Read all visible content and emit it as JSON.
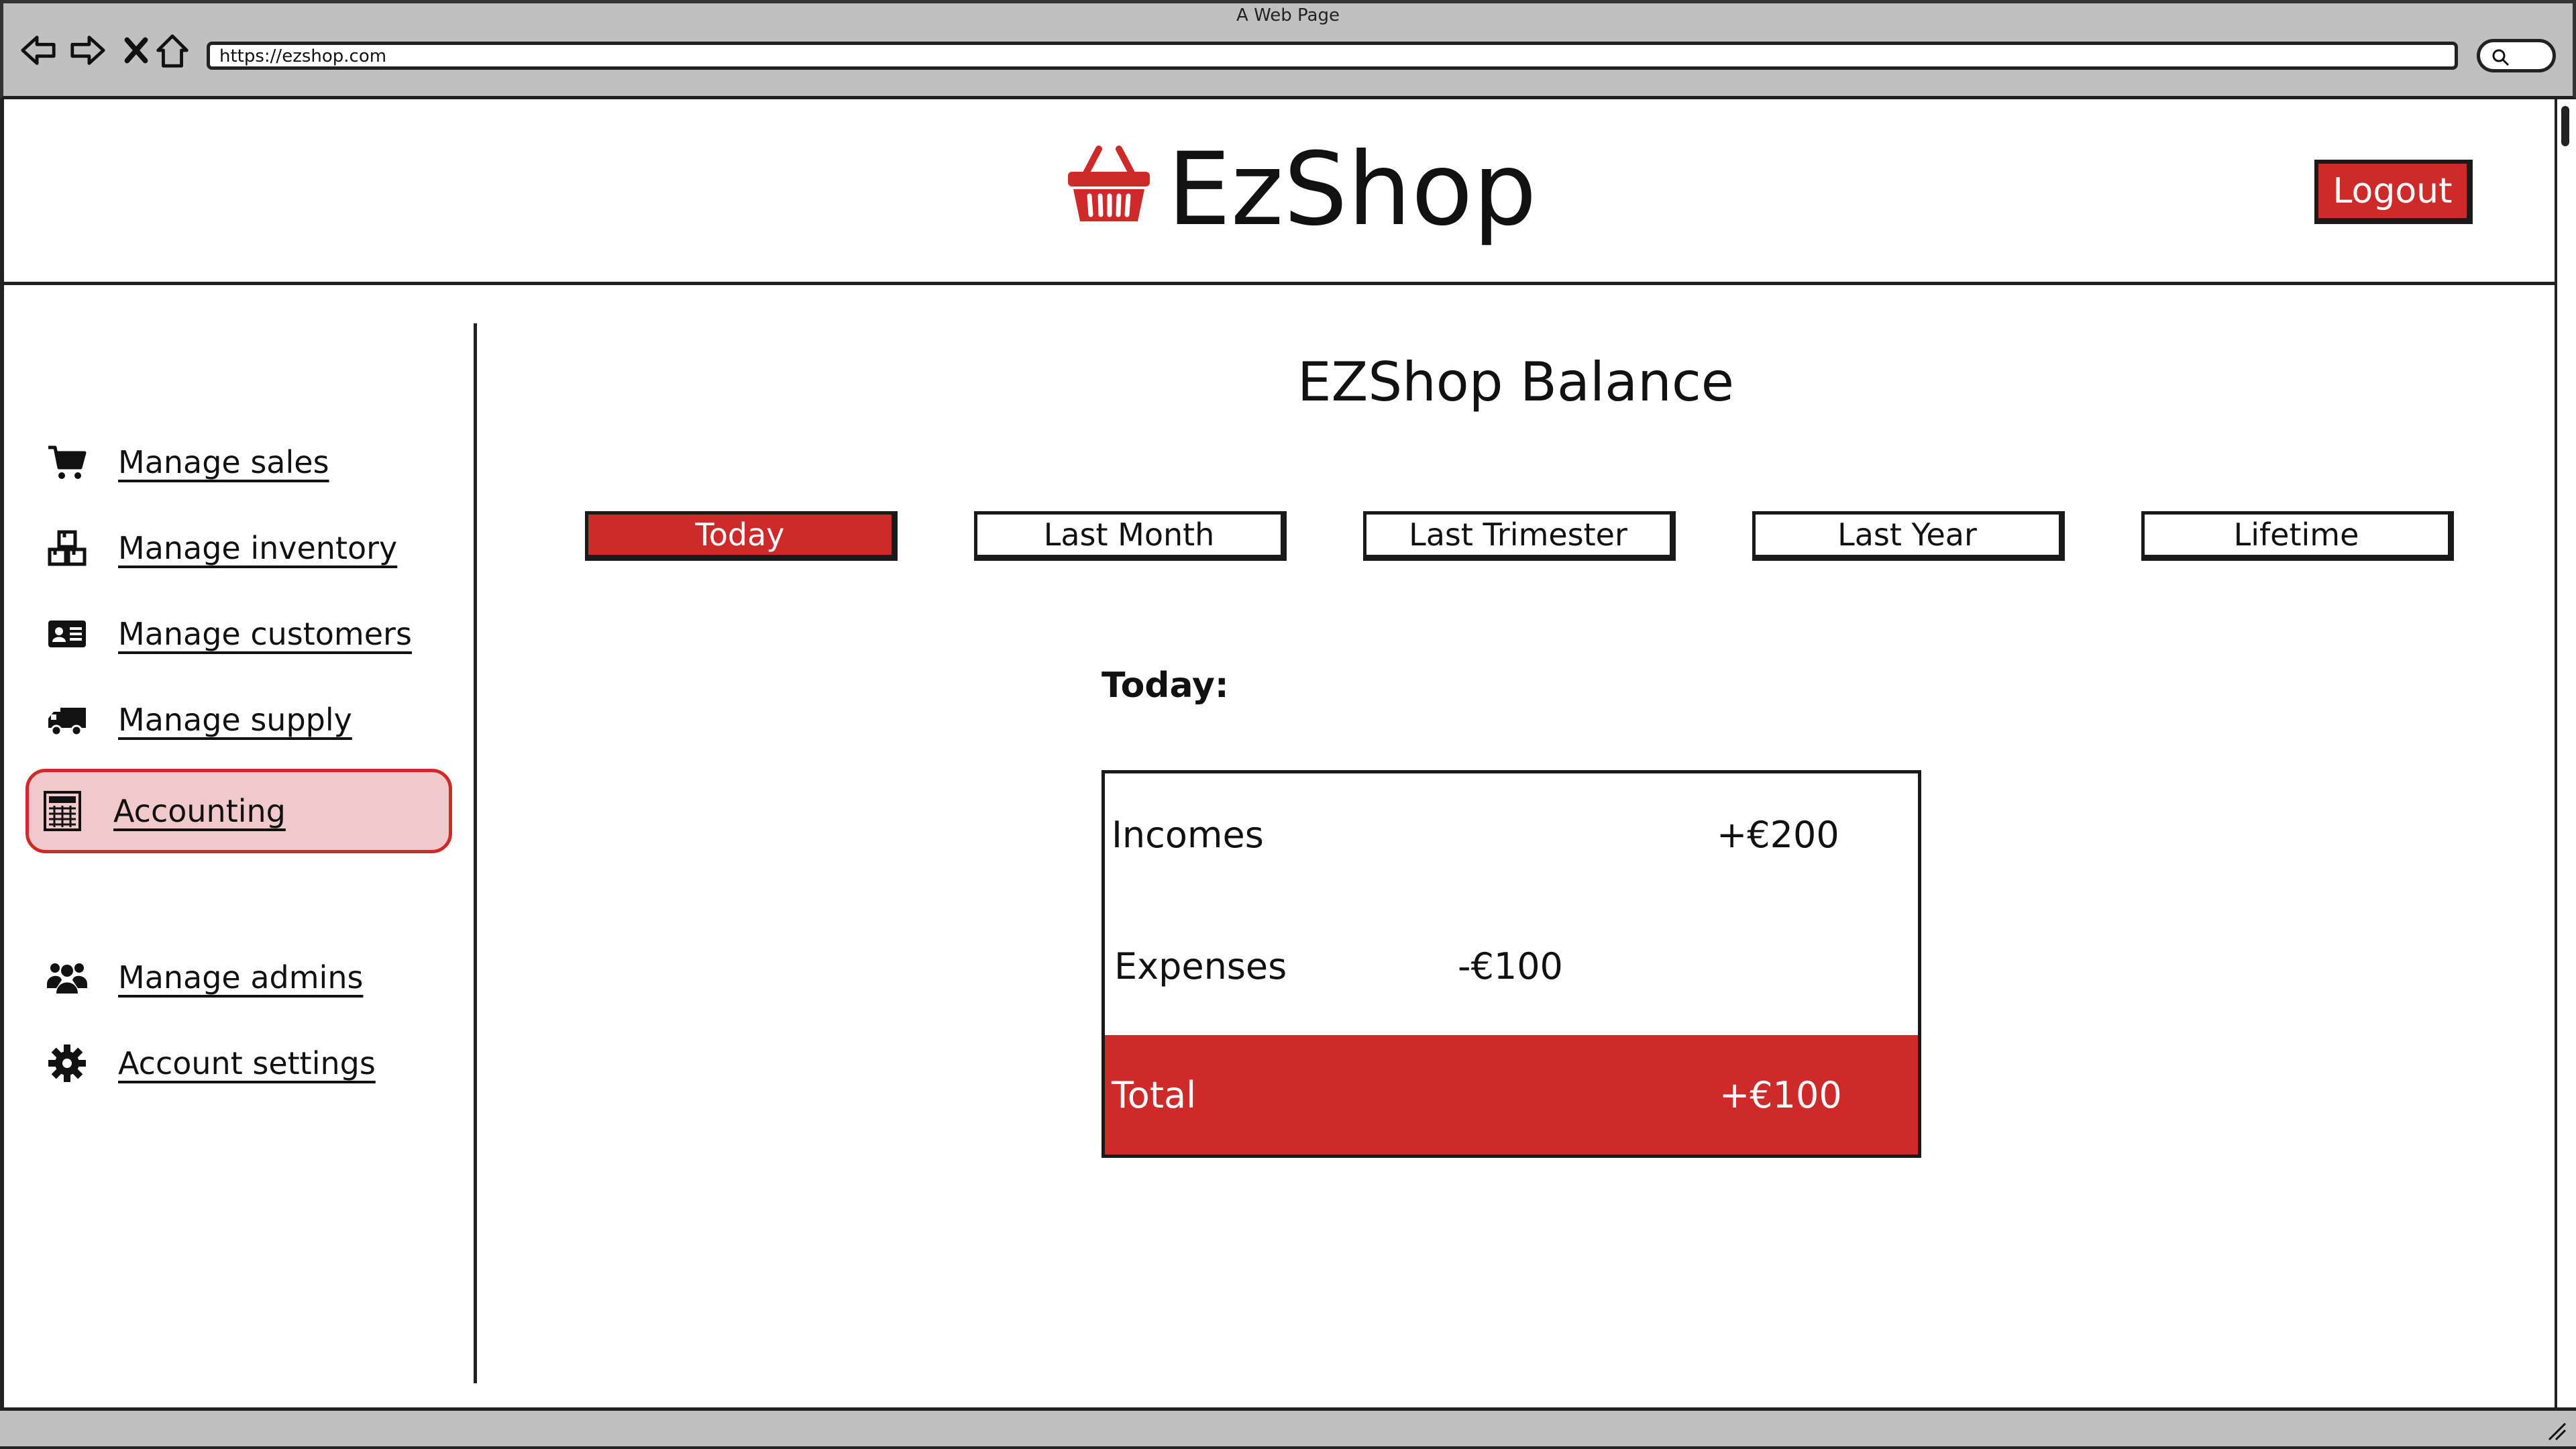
{
  "browser": {
    "page_title": "A Web Page",
    "url": "https://ezshop.com",
    "icons": [
      "back-arrow-icon",
      "forward-arrow-icon",
      "stop-x-icon",
      "home-icon",
      "search-icon"
    ]
  },
  "header": {
    "brand": "EzShop",
    "brand_icon": "shopping-basket-icon",
    "logout_label": "Logout"
  },
  "sidebar": {
    "items": [
      {
        "label": "Manage sales",
        "icon": "shopping-cart-icon"
      },
      {
        "label": "Manage inventory",
        "icon": "boxes-icon"
      },
      {
        "label": "Manage customers",
        "icon": "id-card-icon"
      },
      {
        "label": "Manage supply",
        "icon": "truck-icon"
      },
      {
        "label": "Accounting",
        "icon": "calculator-icon",
        "selected": true
      },
      {
        "label": "Manage admins",
        "icon": "users-icon"
      },
      {
        "label": "Account settings",
        "icon": "gear-icon"
      }
    ]
  },
  "main": {
    "title": "EZShop Balance",
    "tabs": [
      {
        "label": "Today",
        "active": true
      },
      {
        "label": "Last Month"
      },
      {
        "label": "Last Trimester"
      },
      {
        "label": "Last Year"
      },
      {
        "label": "Lifetime"
      }
    ],
    "period_label": "Today:",
    "balance": {
      "incomes_label": "Incomes",
      "incomes_value": "+€200",
      "expenses_label": "Expenses",
      "expenses_value": "-€100",
      "total_label": "Total",
      "total_value": "+€100"
    }
  },
  "colors": {
    "accent": "#cf2a2a",
    "accent_light": "#f2c9cb",
    "chrome": "#c0c0c0"
  }
}
